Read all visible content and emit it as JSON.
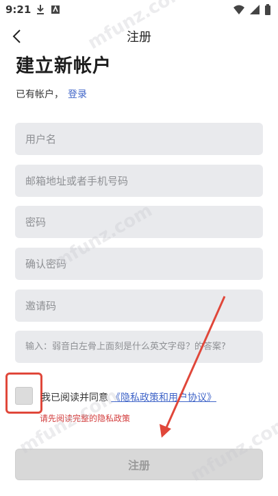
{
  "status_bar": {
    "time": "9:21"
  },
  "app_bar": {
    "title": "注册"
  },
  "heading": "建立新帐户",
  "account_prompt": {
    "text": "已有帐户，",
    "login_link": "登录"
  },
  "form": {
    "username_placeholder": "用户名",
    "email_placeholder": "邮箱地址或者手机号码",
    "password_placeholder": "密码",
    "confirm_password_placeholder": "确认密码",
    "invite_code_placeholder": "邀请码",
    "captcha_placeholder": "输入：弱音白左骨上面刻是什么英文字母？的答案?"
  },
  "agreement": {
    "text": "我已阅读并同意",
    "policy_link": "《隐私政策和用户协议》",
    "checked": false,
    "error": "请先阅读完整的隐私政策"
  },
  "submit_label": "注册",
  "watermark": "mfunz.com",
  "colors": {
    "link": "#3f64c8",
    "error": "#d23b3b",
    "annotation": "#e0473a",
    "field_bg": "#e9eaed",
    "button_disabled": "#d8d8d8"
  }
}
